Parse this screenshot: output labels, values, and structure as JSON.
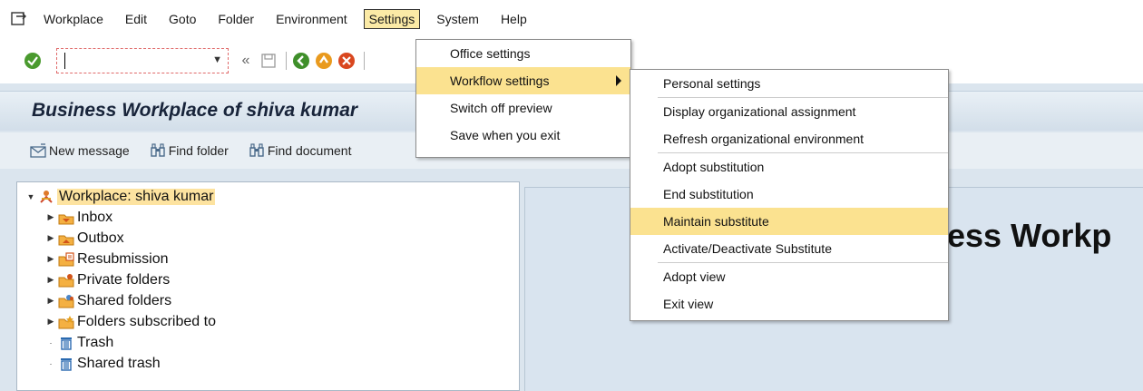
{
  "menubar": {
    "items": [
      {
        "label": "Workplace"
      },
      {
        "label": "Edit"
      },
      {
        "label": "Goto"
      },
      {
        "label": "Folder"
      },
      {
        "label": "Environment"
      },
      {
        "label": "Settings"
      },
      {
        "label": "System"
      },
      {
        "label": "Help"
      }
    ]
  },
  "toolbar": {
    "command_value": ""
  },
  "title": "Business Workplace of shiva kumar",
  "apptoolbar": {
    "new_message": "New message",
    "find_folder": "Find folder",
    "find_document": "Find document"
  },
  "tree": {
    "root": "Workplace: shiva kumar",
    "children": [
      {
        "label": "Inbox"
      },
      {
        "label": "Outbox"
      },
      {
        "label": "Resubmission"
      },
      {
        "label": "Private folders"
      },
      {
        "label": "Shared folders"
      },
      {
        "label": "Folders subscribed to"
      },
      {
        "label": "Trash"
      },
      {
        "label": "Shared trash"
      }
    ]
  },
  "right_panel": {
    "heading": "ess Workp"
  },
  "settings_menu": {
    "items": [
      {
        "label": "Office settings"
      },
      {
        "label": "Workflow settings"
      },
      {
        "label": "Switch off preview"
      },
      {
        "label": "Save when you exit"
      }
    ]
  },
  "workflow_submenu": {
    "items": [
      {
        "label": "Personal settings"
      },
      {
        "label": "Display organizational assignment"
      },
      {
        "label": "Refresh organizational environment"
      },
      {
        "label": "Adopt substitution"
      },
      {
        "label": "End substitution"
      },
      {
        "label": "Maintain substitute"
      },
      {
        "label": "Activate/Deactivate Substitute"
      },
      {
        "label": "Adopt view"
      },
      {
        "label": "Exit view"
      }
    ]
  },
  "colors": {
    "highlight": "#fbe290",
    "background": "#dbe5ee"
  }
}
